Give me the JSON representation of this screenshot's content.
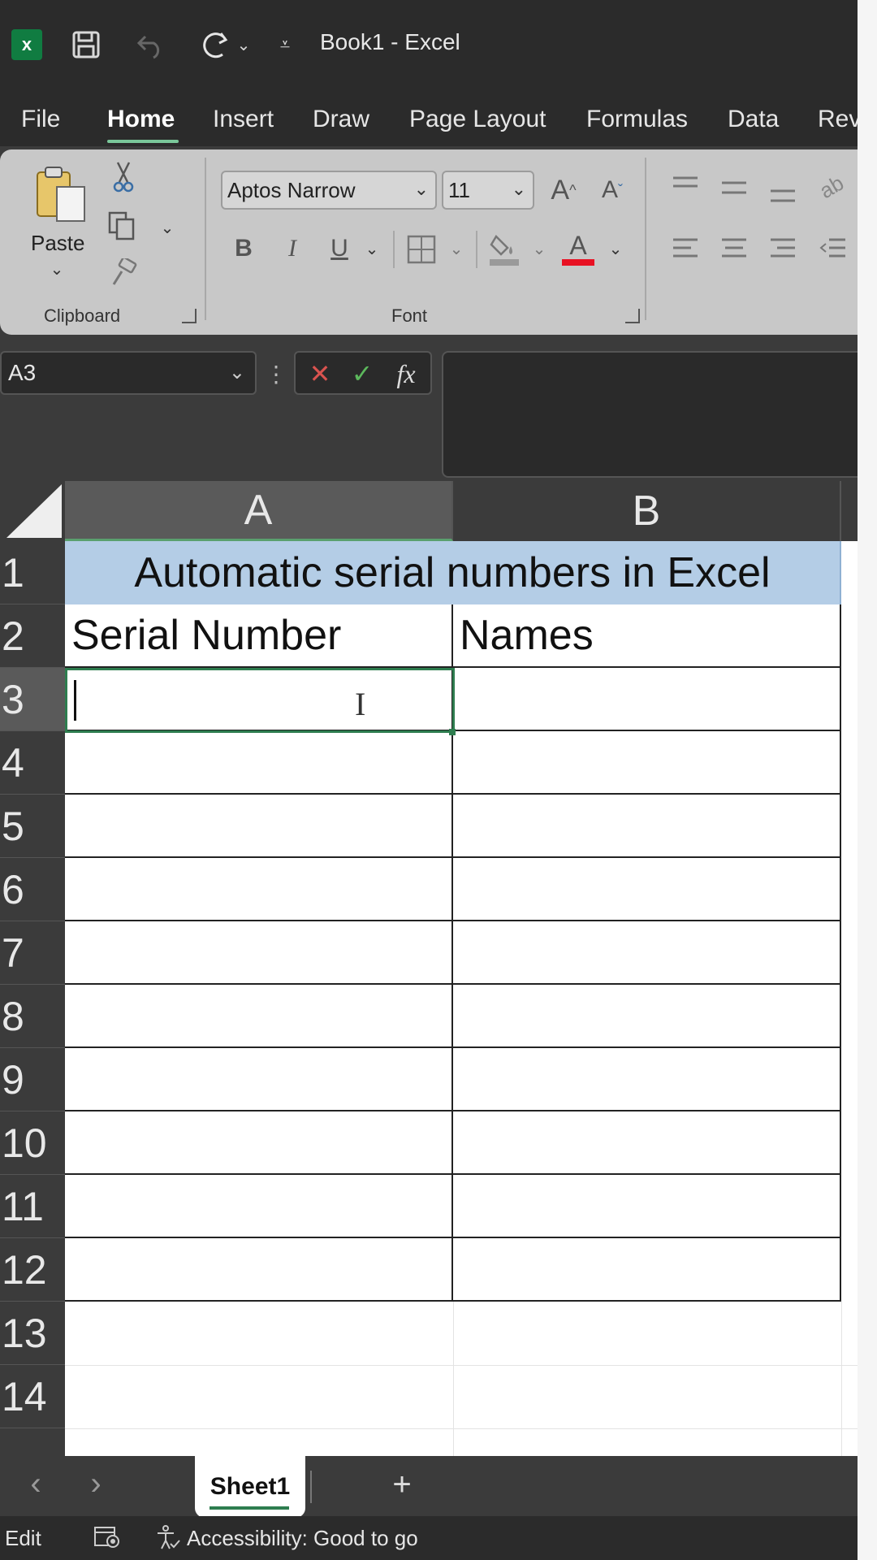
{
  "window": {
    "title": "Book1  -  Excel"
  },
  "tabs": [
    "File",
    "Home",
    "Insert",
    "Draw",
    "Page Layout",
    "Formulas",
    "Data",
    "Rev"
  ],
  "ribbon": {
    "paste_label": "Paste",
    "clipboard_label": "Clipboard",
    "font_label": "Font",
    "font_name": "Aptos Narrow",
    "font_size": "11",
    "bold": "B",
    "italic": "I",
    "underline": "U",
    "grow_font": "A",
    "shrink_font": "A",
    "font_color_letter": "A"
  },
  "formula_bar": {
    "name_box": "A3",
    "fx": "fx",
    "cancel": "✕",
    "enter": "✓",
    "value": ""
  },
  "grid": {
    "columns": [
      "A",
      "B"
    ],
    "rows": [
      "1",
      "2",
      "3",
      "4",
      "5",
      "6",
      "7",
      "8",
      "9",
      "10",
      "11",
      "12",
      "13",
      "14"
    ],
    "banner": "Automatic serial numbers in Excel",
    "headers": [
      "Serial Number",
      "Names"
    ],
    "active_cell": "A3"
  },
  "sheets": [
    "Sheet1"
  ],
  "sheetbar": {
    "prev": "‹",
    "next": "›",
    "add": "+"
  },
  "status": {
    "mode": "Edit",
    "accessibility": "Accessibility: Good to go"
  },
  "colors": {
    "banner_fill": "#b4cde6",
    "selection_green": "#2e7d4f",
    "excel_green": "#107c41",
    "font_color_red": "#e81123"
  }
}
